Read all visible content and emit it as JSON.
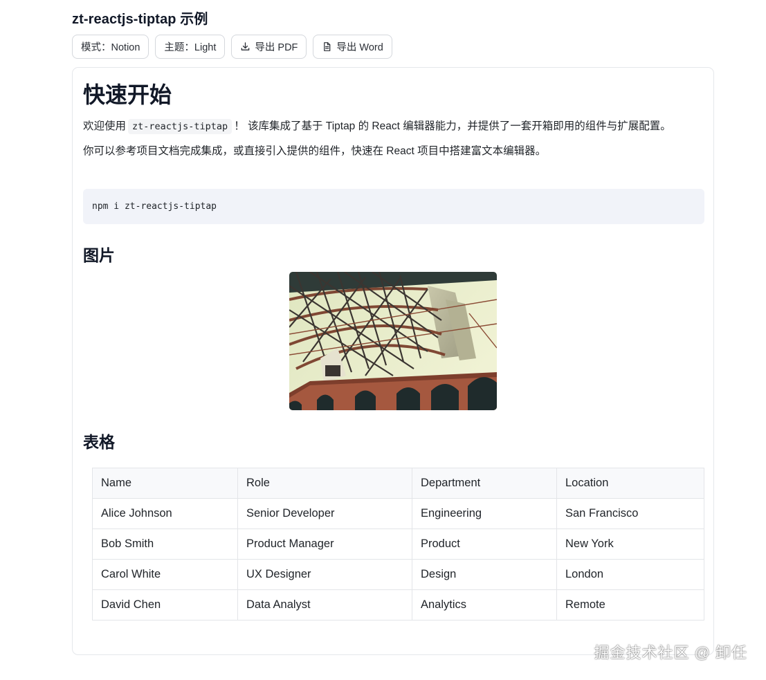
{
  "header": {
    "title": "zt-reactjs-tiptap 示例"
  },
  "toolbar": {
    "mode_label": "模式：Notion",
    "theme_label": "主题：Light",
    "export_pdf_label": "导出 PDF",
    "export_word_label": "导出 Word"
  },
  "doc": {
    "heading": "快速开始",
    "para1_prefix": "欢迎使用",
    "para1_code": "zt-reactjs-tiptap",
    "para1_suffix": "！ 该库集成了基于 Tiptap 的 React 编辑器能力，并提供了一套开箱即用的组件与扩展配置。",
    "para2": "你可以参考项目文档完成集成，或直接引入提供的组件，快速在 React 项目中搭建富文本编辑器。",
    "code_block": "npm i zt-reactjs-tiptap",
    "image_heading": "图片",
    "table_heading": "表格",
    "table": {
      "headers": [
        "Name",
        "Role",
        "Department",
        "Location"
      ],
      "rows": [
        [
          "Alice Johnson",
          "Senior Developer",
          "Engineering",
          "San Francisco"
        ],
        [
          "Bob Smith",
          "Product Manager",
          "Product",
          "New York"
        ],
        [
          "Carol White",
          "UX Designer",
          "Design",
          "London"
        ],
        [
          "David Chen",
          "Data Analyst",
          "Analytics",
          "Remote"
        ]
      ]
    }
  },
  "watermark": "掘金技术社区 @ 卸任",
  "icons": {
    "export_pdf": "download-icon",
    "export_word": "document-icon"
  },
  "colors": {
    "border": "#d4d7dc",
    "code_bg": "#f1f3f9",
    "table_header_bg": "#f8f9fb"
  }
}
